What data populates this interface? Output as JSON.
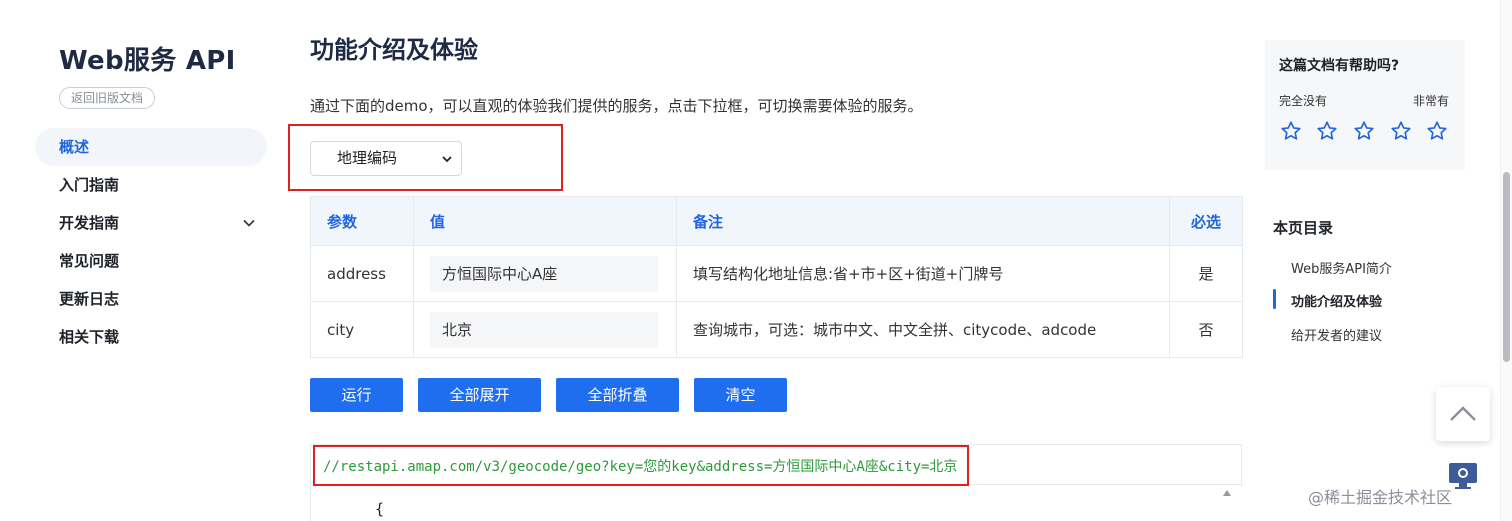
{
  "sidebar": {
    "brand": "Web服务 API",
    "old_doc_button": "返回旧版文档",
    "items": [
      {
        "label": "概述",
        "active": true
      },
      {
        "label": "入门指南"
      },
      {
        "label": "开发指南",
        "expandable": true
      },
      {
        "label": "常见问题"
      },
      {
        "label": "更新日志"
      },
      {
        "label": "相关下载"
      }
    ]
  },
  "main": {
    "title": "功能介绍及体验",
    "intro": "通过下面的demo，可以直观的体验我们提供的服务，点击下拉框，可切换需要体验的服务。",
    "service_select": {
      "value": "地理编码"
    },
    "table": {
      "headers": [
        "参数",
        "值",
        "备注",
        "必选"
      ],
      "rows": [
        {
          "param": "address",
          "value": "方恒国际中心A座",
          "note": "填写结构化地址信息:省+市+区+街道+门牌号",
          "required": "是"
        },
        {
          "param": "city",
          "value": "北京",
          "note": "查询城市，可选：城市中文、中文全拼、citycode、adcode",
          "required": "否"
        }
      ]
    },
    "buttons": {
      "run": "运行",
      "expand_all": "全部展开",
      "collapse_all": "全部折叠",
      "clear": "清空"
    },
    "request_url": "//restapi.amap.com/v3/geocode/geo?key=您的key&address=方恒国际中心A座&city=北京",
    "json_preview_first_line": "{"
  },
  "rail": {
    "feedback": {
      "title": "这篇文档有帮助吗?",
      "left_label": "完全没有",
      "right_label": "非常有",
      "star_icon": "star-outline-icon",
      "star_count": 5
    },
    "toc": {
      "title": "本页目录",
      "items": [
        {
          "label": "Web服务API简介"
        },
        {
          "label": "功能介绍及体验",
          "active": true
        },
        {
          "label": "给开发者的建议"
        }
      ]
    },
    "watermark": "@稀土掘金技术社区"
  },
  "colors": {
    "accent": "#2266dd",
    "button": "#1f6ef0",
    "highlight_box": "#e02020",
    "url_text": "#2e9a3a"
  }
}
